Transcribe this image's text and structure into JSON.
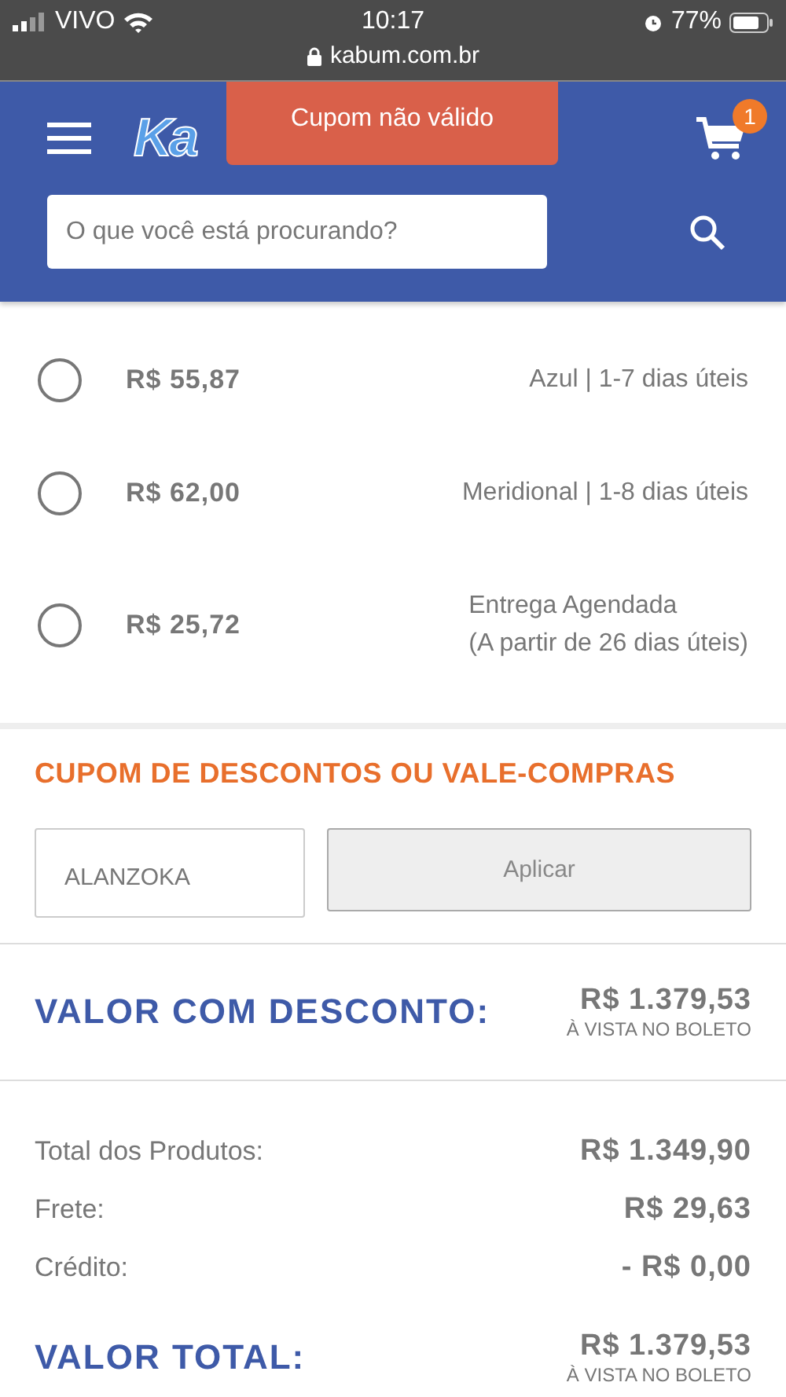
{
  "status_bar": {
    "carrier": "VIVO",
    "time": "10:17",
    "battery": "77%",
    "url": "kabum.com.br"
  },
  "header": {
    "logo": "Ka",
    "cart_count": "1",
    "search": {
      "placeholder": "O que você está procurando?"
    }
  },
  "toast": {
    "text": "Cupom não válido"
  },
  "shipping_options": [
    {
      "price": "R$ 55,87",
      "lines": [
        "Azul | 1-7 dias úteis"
      ],
      "selected": false
    },
    {
      "price": "R$ 62,00",
      "lines": [
        "Meridional | 1-8 dias úteis"
      ],
      "selected": false
    },
    {
      "price": "R$ 25,72",
      "lines": [
        "Entrega Agendada",
        "(A partir de 26 dias úteis)"
      ],
      "selected": false
    }
  ],
  "coupon": {
    "title": "CUPOM DE DESCONTOS OU VALE-COMPRAS",
    "value": "ALANZOKA",
    "button": "Aplicar"
  },
  "discount": {
    "label": "VALOR COM DESCONTO:",
    "amount": "R$ 1.379,53",
    "note": "À VISTA NO BOLETO"
  },
  "summary": [
    {
      "label": "Total dos Produtos:",
      "value": "R$ 1.349,90"
    },
    {
      "label": "Frete:",
      "value": "R$ 29,63"
    },
    {
      "label": "Crédito:",
      "value": "- R$ 0,00"
    }
  ],
  "total": {
    "label": "VALOR TOTAL:",
    "amount": "R$ 1.379,53",
    "note": "À VISTA NO BOLETO"
  }
}
